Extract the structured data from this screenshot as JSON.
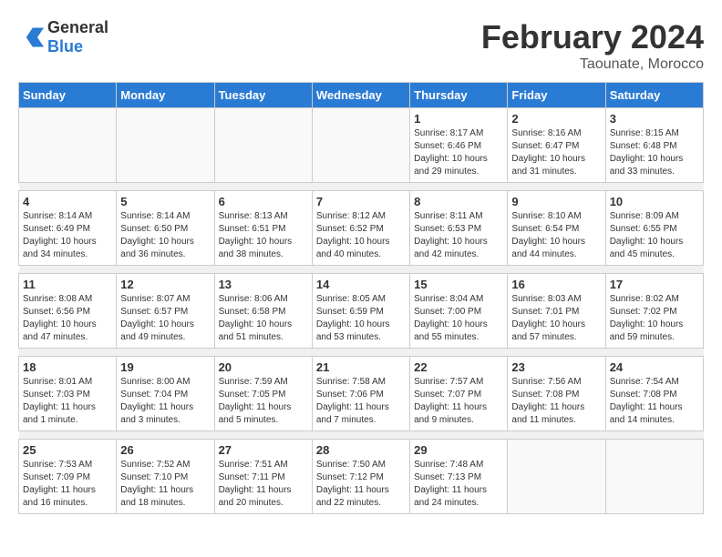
{
  "header": {
    "logo": {
      "general": "General",
      "blue": "Blue"
    },
    "title": "February 2024",
    "subtitle": "Taounate, Morocco"
  },
  "weekdays": [
    "Sunday",
    "Monday",
    "Tuesday",
    "Wednesday",
    "Thursday",
    "Friday",
    "Saturday"
  ],
  "weeks": [
    [
      {
        "day": null,
        "info": null
      },
      {
        "day": null,
        "info": null
      },
      {
        "day": null,
        "info": null
      },
      {
        "day": null,
        "info": null
      },
      {
        "day": "1",
        "info": "Sunrise: 8:17 AM\nSunset: 6:46 PM\nDaylight: 10 hours\nand 29 minutes."
      },
      {
        "day": "2",
        "info": "Sunrise: 8:16 AM\nSunset: 6:47 PM\nDaylight: 10 hours\nand 31 minutes."
      },
      {
        "day": "3",
        "info": "Sunrise: 8:15 AM\nSunset: 6:48 PM\nDaylight: 10 hours\nand 33 minutes."
      }
    ],
    [
      {
        "day": "4",
        "info": "Sunrise: 8:14 AM\nSunset: 6:49 PM\nDaylight: 10 hours\nand 34 minutes."
      },
      {
        "day": "5",
        "info": "Sunrise: 8:14 AM\nSunset: 6:50 PM\nDaylight: 10 hours\nand 36 minutes."
      },
      {
        "day": "6",
        "info": "Sunrise: 8:13 AM\nSunset: 6:51 PM\nDaylight: 10 hours\nand 38 minutes."
      },
      {
        "day": "7",
        "info": "Sunrise: 8:12 AM\nSunset: 6:52 PM\nDaylight: 10 hours\nand 40 minutes."
      },
      {
        "day": "8",
        "info": "Sunrise: 8:11 AM\nSunset: 6:53 PM\nDaylight: 10 hours\nand 42 minutes."
      },
      {
        "day": "9",
        "info": "Sunrise: 8:10 AM\nSunset: 6:54 PM\nDaylight: 10 hours\nand 44 minutes."
      },
      {
        "day": "10",
        "info": "Sunrise: 8:09 AM\nSunset: 6:55 PM\nDaylight: 10 hours\nand 45 minutes."
      }
    ],
    [
      {
        "day": "11",
        "info": "Sunrise: 8:08 AM\nSunset: 6:56 PM\nDaylight: 10 hours\nand 47 minutes."
      },
      {
        "day": "12",
        "info": "Sunrise: 8:07 AM\nSunset: 6:57 PM\nDaylight: 10 hours\nand 49 minutes."
      },
      {
        "day": "13",
        "info": "Sunrise: 8:06 AM\nSunset: 6:58 PM\nDaylight: 10 hours\nand 51 minutes."
      },
      {
        "day": "14",
        "info": "Sunrise: 8:05 AM\nSunset: 6:59 PM\nDaylight: 10 hours\nand 53 minutes."
      },
      {
        "day": "15",
        "info": "Sunrise: 8:04 AM\nSunset: 7:00 PM\nDaylight: 10 hours\nand 55 minutes."
      },
      {
        "day": "16",
        "info": "Sunrise: 8:03 AM\nSunset: 7:01 PM\nDaylight: 10 hours\nand 57 minutes."
      },
      {
        "day": "17",
        "info": "Sunrise: 8:02 AM\nSunset: 7:02 PM\nDaylight: 10 hours\nand 59 minutes."
      }
    ],
    [
      {
        "day": "18",
        "info": "Sunrise: 8:01 AM\nSunset: 7:03 PM\nDaylight: 11 hours\nand 1 minute."
      },
      {
        "day": "19",
        "info": "Sunrise: 8:00 AM\nSunset: 7:04 PM\nDaylight: 11 hours\nand 3 minutes."
      },
      {
        "day": "20",
        "info": "Sunrise: 7:59 AM\nSunset: 7:05 PM\nDaylight: 11 hours\nand 5 minutes."
      },
      {
        "day": "21",
        "info": "Sunrise: 7:58 AM\nSunset: 7:06 PM\nDaylight: 11 hours\nand 7 minutes."
      },
      {
        "day": "22",
        "info": "Sunrise: 7:57 AM\nSunset: 7:07 PM\nDaylight: 11 hours\nand 9 minutes."
      },
      {
        "day": "23",
        "info": "Sunrise: 7:56 AM\nSunset: 7:08 PM\nDaylight: 11 hours\nand 11 minutes."
      },
      {
        "day": "24",
        "info": "Sunrise: 7:54 AM\nSunset: 7:08 PM\nDaylight: 11 hours\nand 14 minutes."
      }
    ],
    [
      {
        "day": "25",
        "info": "Sunrise: 7:53 AM\nSunset: 7:09 PM\nDaylight: 11 hours\nand 16 minutes."
      },
      {
        "day": "26",
        "info": "Sunrise: 7:52 AM\nSunset: 7:10 PM\nDaylight: 11 hours\nand 18 minutes."
      },
      {
        "day": "27",
        "info": "Sunrise: 7:51 AM\nSunset: 7:11 PM\nDaylight: 11 hours\nand 20 minutes."
      },
      {
        "day": "28",
        "info": "Sunrise: 7:50 AM\nSunset: 7:12 PM\nDaylight: 11 hours\nand 22 minutes."
      },
      {
        "day": "29",
        "info": "Sunrise: 7:48 AM\nSunset: 7:13 PM\nDaylight: 11 hours\nand 24 minutes."
      },
      {
        "day": null,
        "info": null
      },
      {
        "day": null,
        "info": null
      }
    ]
  ]
}
